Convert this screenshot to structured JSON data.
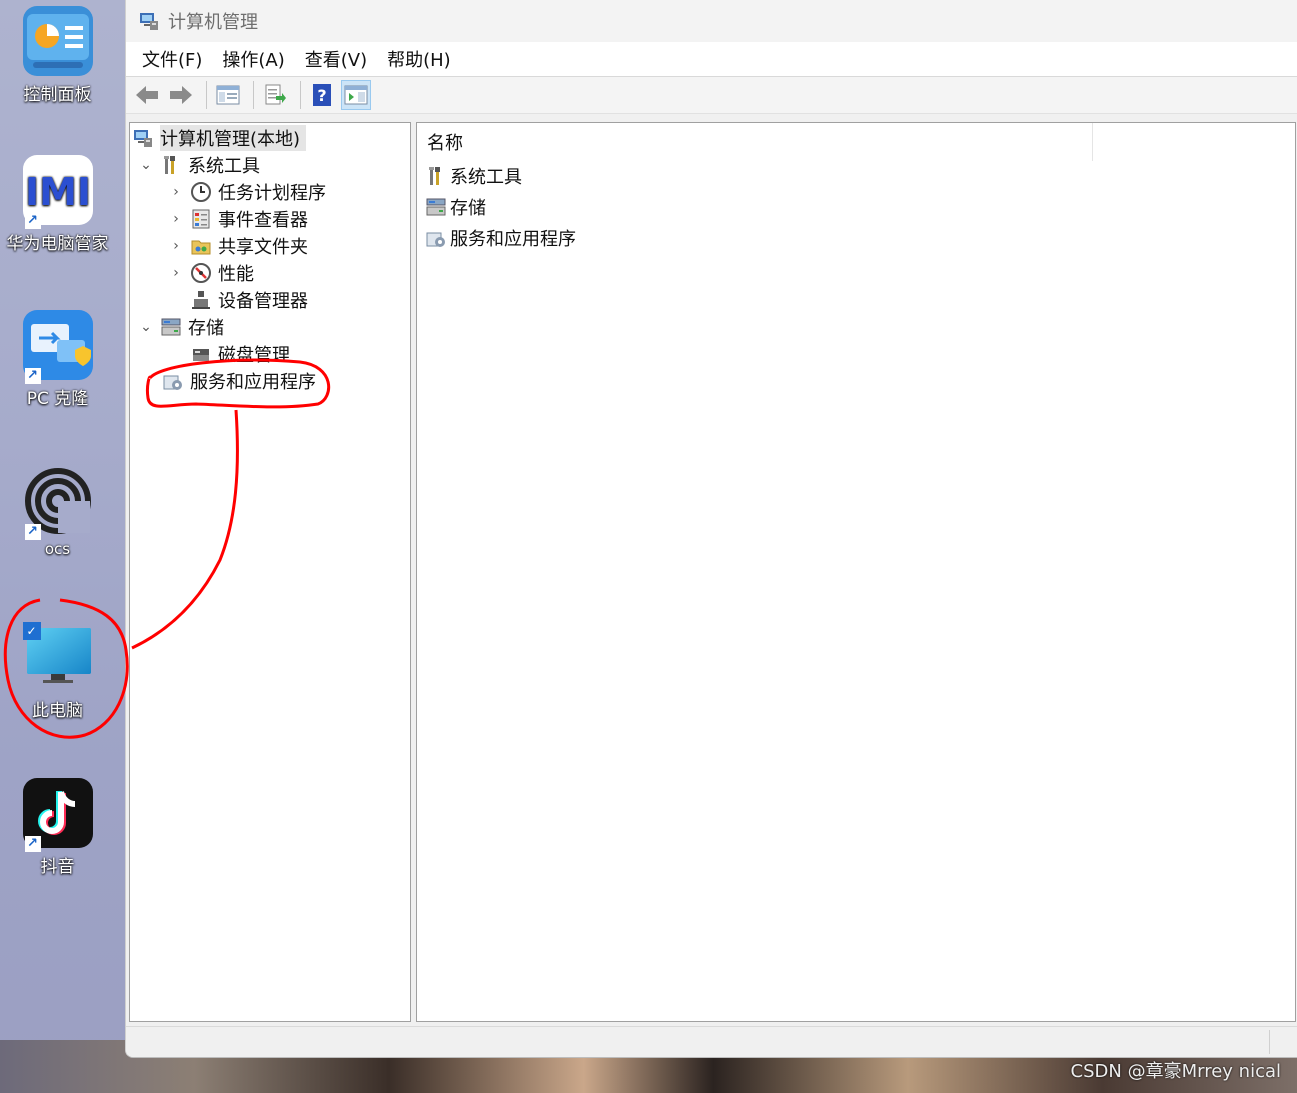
{
  "desktop": {
    "icons": [
      {
        "label": "控制面板"
      },
      {
        "label": "华为电脑管家"
      },
      {
        "label": "PC 克隆"
      },
      {
        "label": "ocs"
      },
      {
        "label": "此电脑"
      },
      {
        "label": "抖音"
      }
    ],
    "watermark": "CSDN @章豪Mrrey nical"
  },
  "window": {
    "title": "计算机管理",
    "menu": [
      "文件(F)",
      "操作(A)",
      "查看(V)",
      "帮助(H)"
    ],
    "tree": {
      "root": "计算机管理(本地)",
      "system_tools": "系统工具",
      "task_scheduler": "任务计划程序",
      "event_viewer": "事件查看器",
      "shared_folders": "共享文件夹",
      "performance": "性能",
      "device_manager": "设备管理器",
      "storage": "存储",
      "disk_management": "磁盘管理",
      "services_apps": "服务和应用程序"
    },
    "content": {
      "column_name": "名称",
      "rows": [
        "系统工具",
        "存储",
        "服务和应用程序"
      ]
    }
  },
  "colors": {
    "annotation": "#ff0000",
    "selection_bg": "#e5e5e5",
    "toolbar_active": "#cce4f7"
  }
}
